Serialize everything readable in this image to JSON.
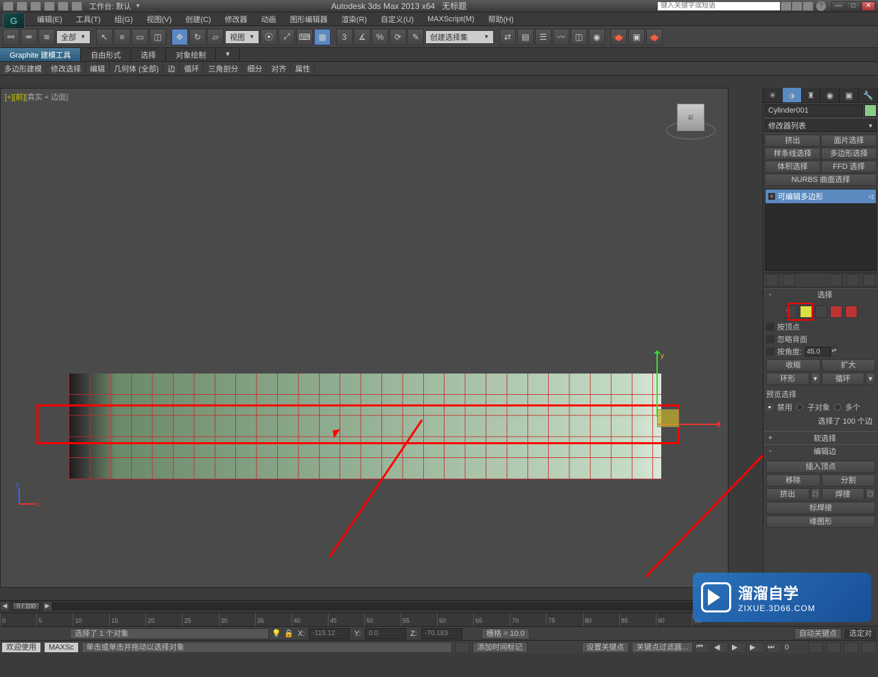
{
  "title": {
    "workspace_lbl": "工作台: 默认",
    "app": "Autodesk 3ds Max  2013  x64",
    "doc": "无标题",
    "search_placeholder": "键入关键字或短语",
    "help": "?"
  },
  "menu": {
    "edit": "编辑(E)",
    "tools": "工具(T)",
    "group": "组(G)",
    "views": "视图(V)",
    "create": "创建(C)",
    "modifiers": "修改器",
    "animation": "动画",
    "graph": "图形编辑器",
    "render": "渲染(R)",
    "custom": "自定义(U)",
    "maxscript": "MAXScript(M)",
    "help": "帮助(H)"
  },
  "toolbar": {
    "filter_combo": "全部",
    "view_combo": "视图",
    "named_sel": "创建选择集"
  },
  "ribbon": {
    "tabs": {
      "model": "Graphite 建模工具",
      "freeform": "自由形式",
      "select": "选择",
      "objpaint": "对象绘制"
    },
    "sub": {
      "poly": "多边形建模",
      "modsel": "修改选择",
      "edit": "编辑",
      "geomall": "几何体 (全部)",
      "edge": "边",
      "loop": "循环",
      "tri": "三角剖分",
      "subdiv": "细分",
      "align": "对齐",
      "props": "属性"
    }
  },
  "viewport": {
    "label_prefix": "[+][前]",
    "label_mode": "[真实 + 边面]",
    "y": "y",
    "cube": "前"
  },
  "cmd": {
    "obj_name": "Cylinder001",
    "mod_list": "修改器列表",
    "buttons": {
      "extrude": "挤出",
      "faceSel": "面片选择",
      "splineSel": "样条线选择",
      "polySel": "多边形选择",
      "volSel": "体积选择",
      "ffdSel": "FFD 选择",
      "nurbs": "NURBS 曲面选择"
    },
    "stack_item": "可编辑多边形"
  },
  "rollouts": {
    "selection": {
      "title": "选择",
      "by_vertex": "按顶点",
      "ignore_back": "忽略背面",
      "by_angle": "按角度:",
      "angle_val": "45.0",
      "shrink": "收缩",
      "grow": "扩大",
      "ring": "环形",
      "loop": "循环",
      "preview": "预览选择",
      "disable": "禁用",
      "subobj": "子对象",
      "multi": "多个",
      "info": "选择了 100 个边"
    },
    "soft": "软选择",
    "editedge": {
      "title": "编辑边",
      "insert_vtx": "插入顶点",
      "remove": "移除",
      "split": "分割",
      "extrude": "挤出",
      "weld": "焊接",
      "target_weld": "标焊接",
      "edge_shape": "缘图形"
    }
  },
  "timeline": {
    "pos": "0 / 100",
    "ticks": [
      "0",
      "5",
      "10",
      "15",
      "20",
      "25",
      "30",
      "35",
      "40",
      "45",
      "50",
      "55",
      "60",
      "65",
      "70",
      "75",
      "80",
      "85",
      "90",
      "95"
    ]
  },
  "status": {
    "sel_count": "选择了 1 个对象",
    "x": "-115.12",
    "y": "0.0",
    "z": "-70.183",
    "grid": "栅格 = 10.0",
    "autokey": "自动关键点",
    "selset": "选定对",
    "welcome": "欢迎使用",
    "maxs": "MAXSc",
    "hint": "单击或单击并拖动以选择对象",
    "addtag": "添加时间标记",
    "setkey": "设置关键点",
    "keyfilter": "关键点过滤器...",
    "frame": "0"
  },
  "watermark": {
    "cn": "溜溜自学",
    "url": "ZIXUE.3D66.COM"
  }
}
